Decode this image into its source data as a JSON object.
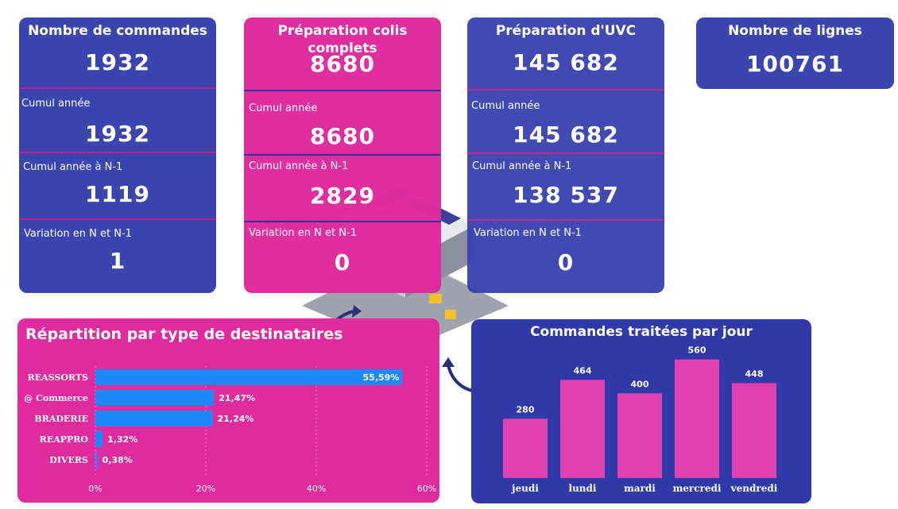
{
  "cards": [
    {
      "title": "Nombre de commandes",
      "value": "1932",
      "cumul_label": "Cumul année",
      "cumul_value": "1932",
      "cumul_n1_label": "Cumul année à N-1",
      "cumul_n1_value": "1119",
      "variation_label": "Variation en N et N-1",
      "variation_value": "1"
    },
    {
      "title": "Préparation colis complets",
      "value": "8680",
      "cumul_label": "Cumul année",
      "cumul_value": "8680",
      "cumul_n1_label": "Cumul année à N-1",
      "cumul_n1_value": "2829",
      "variation_label": "Variation en N et N-1",
      "variation_value": "0"
    },
    {
      "title": "Préparation d'UVC",
      "value": "145 682",
      "cumul_label": "Cumul année",
      "cumul_value": "145 682",
      "cumul_n1_label": "Cumul année à N-1",
      "cumul_n1_value": "138 537",
      "variation_label": "Variation en N et N-1",
      "variation_value": "0"
    },
    {
      "title": "Nombre de lignes",
      "value": "100761"
    }
  ],
  "colors": {
    "blue": "#3a45b0",
    "pink": "#e02aa0",
    "bar_blue": "#1e88ff",
    "bar_pink": "#e040b0"
  },
  "chart_data": [
    {
      "type": "bar",
      "orientation": "horizontal",
      "title": "Répartition par type de destinataires",
      "categories": [
        "REASSORTS",
        "@ Commerce",
        "BRADERIE",
        "REAPPRO",
        "DIVERS"
      ],
      "values": [
        55.59,
        21.47,
        21.24,
        1.32,
        0.38
      ],
      "value_labels": [
        "55,59%",
        "21,47%",
        "21,24%",
        "1,32%",
        "0,38%"
      ],
      "xlim": [
        0,
        60
      ],
      "xticks": [
        "0%",
        "20%",
        "40%",
        "60%"
      ],
      "grid": true
    },
    {
      "type": "bar",
      "title": "Commandes traitées par jour",
      "categories": [
        "jeudi",
        "lundi",
        "mardi",
        "mercredi",
        "vendredi"
      ],
      "values": [
        280,
        464,
        400,
        560,
        448
      ],
      "ylim": [
        0,
        600
      ]
    }
  ]
}
